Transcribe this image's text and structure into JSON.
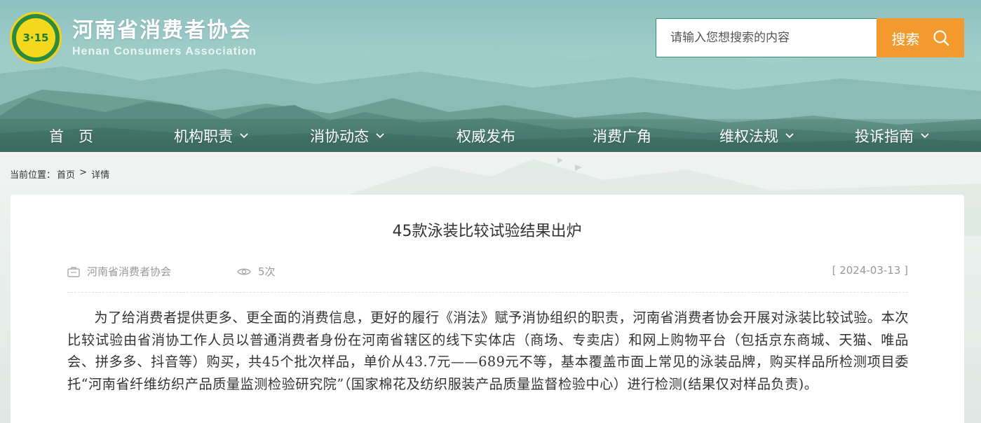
{
  "site": {
    "logo_mark": "3·15",
    "name_cn": "河南省消费者协会",
    "name_en": "Henan Consumers Association"
  },
  "search": {
    "placeholder": "请输入您想搜索的内容",
    "button_label": "搜索",
    "button_icon": "search-icon",
    "button_color": "#f29a2e"
  },
  "nav": {
    "items": [
      {
        "label": "首　页",
        "has_dropdown": false
      },
      {
        "label": "机构职责",
        "has_dropdown": true
      },
      {
        "label": "消协动态",
        "has_dropdown": true
      },
      {
        "label": "权威发布",
        "has_dropdown": false
      },
      {
        "label": "消费广角",
        "has_dropdown": false
      },
      {
        "label": "维权法规",
        "has_dropdown": true
      },
      {
        "label": "投诉指南",
        "has_dropdown": true
      }
    ]
  },
  "breadcrumb": {
    "prefix": "当前位置：",
    "home": "首页",
    "separator": " > ",
    "current": "详情"
  },
  "article": {
    "title": "45款泳装比较试验结果出炉",
    "source": "河南省消费者协会",
    "views": "5次",
    "date": "[ 2024-03-13 ]",
    "body": "为了给消费者提供更多、更全面的消费信息，更好的履行《消法》赋予消协组织的职责，河南省消费者协会开展对泳装比较试验。本次比较试验由省消协工作人员以普通消费者身份在河南省辖区的线下实体店（商场、专卖店）和网上购物平台（包括京东商城、天猫、唯品会、拼多多、抖音等）购买，共45个批次样品，单价从43.7元——689元不等，基本覆盖市面上常见的泳装品牌，购买样品所检测项目委托“河南省纤维纺织产品质量监测检验研究院”（国家棉花及纺织服装产品质量监督检验中心）进行检测(结果仅对样品负责)。"
  },
  "colors": {
    "accent_orange": "#f29a2e",
    "search_border": "#2f9174",
    "logo_green": "#2a8a3e",
    "logo_yellow": "#f4d81e"
  }
}
